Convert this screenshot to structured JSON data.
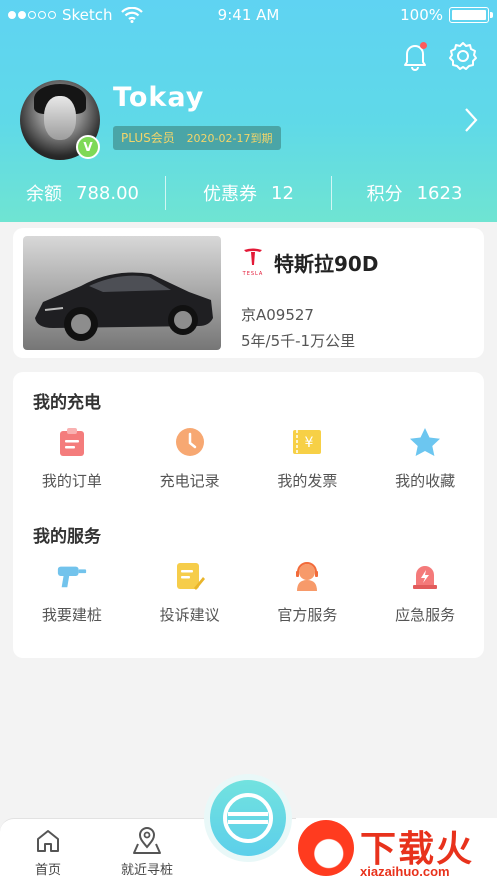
{
  "status_bar": {
    "carrier": "Sketch",
    "time": "9:41 AM",
    "battery": "100%"
  },
  "profile": {
    "name": "Tokay",
    "membership": "PLUS会员",
    "expiry": "2020-02-17到期",
    "verified_mark": "V"
  },
  "stats": [
    {
      "label": "余额",
      "value": "788.00"
    },
    {
      "label": "优惠券",
      "value": "12"
    },
    {
      "label": "积分",
      "value": "1623"
    }
  ],
  "car": {
    "brand_logo_text": "TESLA",
    "model": "特斯拉90D",
    "plate": "京A09527",
    "warranty": "5年/5千-1万公里"
  },
  "charging": {
    "title": "我的充电",
    "items": [
      {
        "label": "我的订单",
        "icon": "clipboard-icon"
      },
      {
        "label": "充电记录",
        "icon": "clock-icon"
      },
      {
        "label": "我的发票",
        "icon": "invoice-icon"
      },
      {
        "label": "我的收藏",
        "icon": "star-icon"
      }
    ]
  },
  "services": {
    "title": "我的服务",
    "items": [
      {
        "label": "我要建桩",
        "icon": "drill-icon"
      },
      {
        "label": "投诉建议",
        "icon": "complaint-icon"
      },
      {
        "label": "官方服务",
        "icon": "headset-icon"
      },
      {
        "label": "应急服务",
        "icon": "emergency-icon"
      }
    ]
  },
  "tabbar": {
    "home": "首页",
    "nearby": "就近寻桩"
  },
  "watermark": {
    "title": "下载火",
    "url": "xiazaihuo.com"
  },
  "colors": {
    "header_top": "#5fd3f2",
    "header_bottom": "#6fe4d2",
    "accent_red": "#ff5b5b",
    "plus_gold": "#f3d56a"
  }
}
